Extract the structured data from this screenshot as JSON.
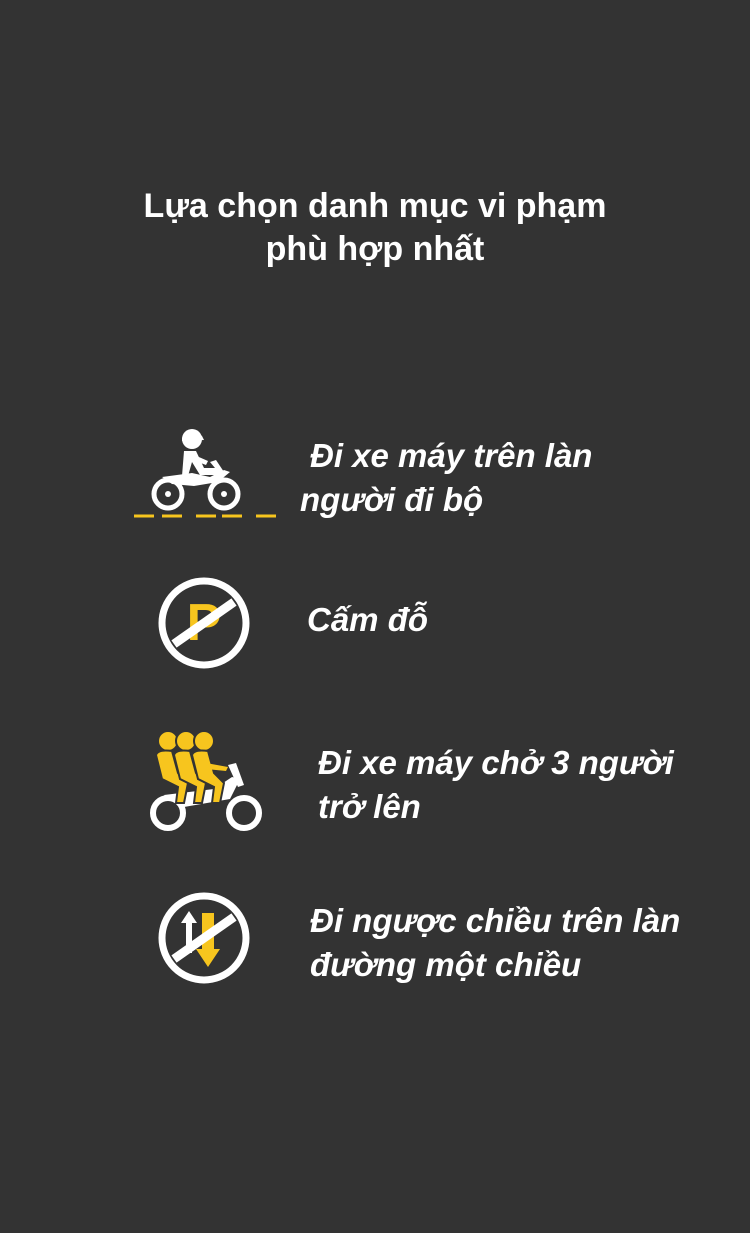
{
  "title": {
    "line1": "Lựa chọn danh mục vi phạm",
    "line2": "phù hợp nhất"
  },
  "colors": {
    "background": "#333333",
    "text": "#ffffff",
    "accent": "#f7c51e"
  },
  "options": [
    {
      "icon": "motorbike-on-sidewalk-icon",
      "line1": "Đi xe máy trên làn",
      "line2": "người đi bộ"
    },
    {
      "icon": "no-parking-icon",
      "line1": "Cấm đỗ",
      "line2": ""
    },
    {
      "icon": "three-riders-motorbike-icon",
      "line1": "Đi xe máy chở 3 người",
      "line2": "trở lên"
    },
    {
      "icon": "no-wrong-way-icon",
      "line1": "Đi ngược chiều trên làn",
      "line2": "đường một chiều"
    }
  ]
}
